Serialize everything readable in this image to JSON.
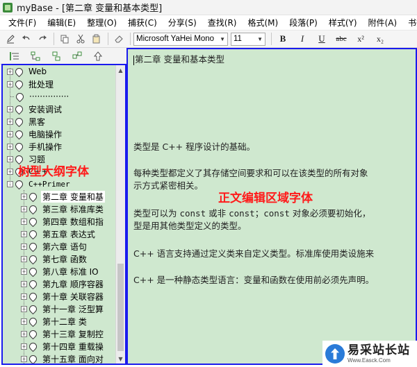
{
  "window": {
    "title": "myBase - [第二章 变量和基本类型]",
    "icon": "app-icon"
  },
  "menubar": {
    "items": [
      "文件(F)",
      "编辑(E)",
      "整理(O)",
      "捕获(C)",
      "分享(S)",
      "查找(R)",
      "格式(M)",
      "段落(P)",
      "样式(Y)",
      "附件(A)",
      "书签("
    ]
  },
  "toolbar": {
    "font_name": "Microsoft YaHei Mono",
    "font_size": "11",
    "format_buttons": [
      "B",
      "I",
      "U",
      "abc",
      "x²",
      "x₂"
    ]
  },
  "tree": {
    "items": [
      {
        "label": "Web",
        "level": 0,
        "expander": "+",
        "mono": false
      },
      {
        "label": "批处理",
        "level": 0,
        "expander": "+",
        "mono": false
      },
      {
        "label": "···············",
        "level": 0,
        "expander": "",
        "mono": false
      },
      {
        "label": "安装调试",
        "level": 0,
        "expander": "+",
        "mono": false
      },
      {
        "label": "黑客",
        "level": 0,
        "expander": "+",
        "mono": false
      },
      {
        "label": "电脑操作",
        "level": 0,
        "expander": "+",
        "mono": false
      },
      {
        "label": "手机操作",
        "level": 0,
        "expander": "+",
        "mono": false
      },
      {
        "label": "习题",
        "level": 0,
        "expander": "+",
        "mono": false
      },
      {
        "label": "C++",
        "level": 0,
        "expander": "+",
        "mono": false
      },
      {
        "label": "C++Primer",
        "level": 0,
        "expander": "-",
        "mono": true
      },
      {
        "label": "第二章  变量和基",
        "level": 1,
        "expander": "+",
        "mono": false,
        "selected": true
      },
      {
        "label": "第三章  标准库类",
        "level": 1,
        "expander": "+",
        "mono": false
      },
      {
        "label": "第四章  数组和指",
        "level": 1,
        "expander": "+",
        "mono": false
      },
      {
        "label": "第五章  表达式",
        "level": 1,
        "expander": "+",
        "mono": false
      },
      {
        "label": "第六章  语句",
        "level": 1,
        "expander": "+",
        "mono": false
      },
      {
        "label": "第七章  函数",
        "level": 1,
        "expander": "+",
        "mono": false
      },
      {
        "label": "第八章  标准 IO",
        "level": 1,
        "expander": "+",
        "mono": false
      },
      {
        "label": "第九章  顺序容器",
        "level": 1,
        "expander": "+",
        "mono": false
      },
      {
        "label": "第十章  关联容器",
        "level": 1,
        "expander": "+",
        "mono": false
      },
      {
        "label": "第十一章  泛型算",
        "level": 1,
        "expander": "+",
        "mono": false
      },
      {
        "label": "第十二章  类",
        "level": 1,
        "expander": "+",
        "mono": false
      },
      {
        "label": "第十三章  复制控",
        "level": 1,
        "expander": "+",
        "mono": false
      },
      {
        "label": "第十四章  重载操",
        "level": 1,
        "expander": "+",
        "mono": false
      },
      {
        "label": "第十五章  面向对",
        "level": 1,
        "expander": "+",
        "mono": false
      },
      {
        "label": "",
        "level": 1,
        "expander": "+",
        "mono": false
      }
    ],
    "overlay_label": "树型大纲字体"
  },
  "editor": {
    "heading": "第二章    变量和基本类型",
    "p1": "类型是 C++ 程序设计的基础。",
    "p2a": "每种类型都定义了其存储空间要求和可以在该类型的所有对象",
    "p2b": "示方式紧密相关。",
    "p3a_1": "类型可以为 ",
    "p3a_c1": "const",
    "p3a_2": " 或非 ",
    "p3a_c2": "const",
    "p3a_3": "；",
    "p3a_c3": "const",
    "p3a_4": " 对象必须要初始化，",
    "p3b": "型是用其他类型定义的类型。",
    "p4": "C++ 语言支持通过定义类来自定义类型。标准库使用类设施来",
    "p5": "C++ 是一种静态类型语言：变量和函数在使用前必须先声明。",
    "overlay_label": "正文编辑区域字体"
  },
  "watermark": {
    "main": "易采站长站",
    "sub": "Www.Easck.Com"
  }
}
